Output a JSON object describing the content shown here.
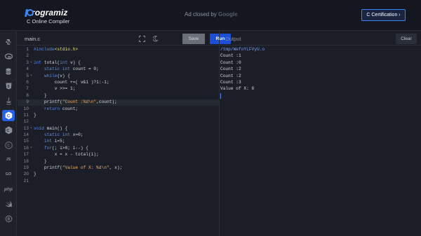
{
  "header": {
    "logo_text": "rogramiz",
    "subtitle": "C Online Compiler",
    "ad_text": "Ad closed by",
    "ad_brand": "Google",
    "cert_button": "C Certification ›"
  },
  "sidebar": {
    "items": [
      {
        "icon": "python-icon"
      },
      {
        "icon": "r-icon"
      },
      {
        "icon": "sql-icon"
      },
      {
        "icon": "html-icon"
      },
      {
        "icon": "java-icon"
      },
      {
        "icon": "c-icon",
        "active": true
      },
      {
        "icon": "cpp-icon"
      },
      {
        "icon": "csharp-icon"
      },
      {
        "icon": "javascript-icon",
        "label": "JS"
      },
      {
        "icon": "go-icon",
        "label": "GO"
      },
      {
        "icon": "php-icon",
        "label": "php"
      },
      {
        "icon": "swift-icon"
      },
      {
        "icon": "rust-icon"
      }
    ]
  },
  "editor": {
    "file_name": "main.c",
    "save_label": "Save",
    "run_label": "Run",
    "line_numbers": [
      "1",
      "2",
      "3",
      "4",
      "5",
      "6",
      "7",
      "8",
      "9",
      "10",
      "11",
      "12",
      "13",
      "14",
      "15",
      "16",
      "17",
      "18",
      "19",
      "20",
      "21"
    ],
    "folds": [
      3,
      5,
      13,
      16
    ],
    "highlighted_line": 9
  },
  "output": {
    "title": "Output",
    "clear_label": "Clear",
    "lines": [
      "/tmp/WefoYLFVyU.o",
      "Count :1",
      "Count :0",
      "Count :2",
      "Count :2",
      "Count :3",
      "Value of X: 8"
    ]
  },
  "colors": {
    "accent": "#2563eb",
    "background": "#1b1e26",
    "keyword": "#5b8cf0",
    "string": "#f0b06a"
  }
}
